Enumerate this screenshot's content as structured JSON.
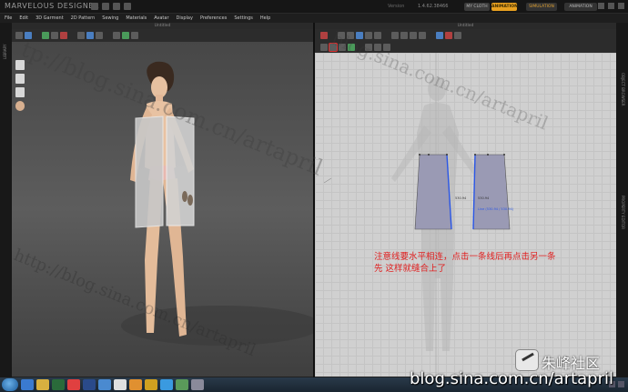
{
  "app": {
    "title": "MARVELOUS DESIGNER 4",
    "version_label": "Version",
    "version_value": "1.4.62.38466",
    "cloud_label": "MY CLOTH",
    "animation_label": "ANIMATION",
    "simulation_label": "SIMULATION",
    "mode2_label": "ANIMATION"
  },
  "menu": [
    "File",
    "Edit",
    "3D Garment",
    "2D Pattern",
    "Sewing",
    "Materials",
    "Avatar",
    "Display",
    "Preferences",
    "Settings",
    "Help"
  ],
  "panels": {
    "left_header": "Untitled",
    "right_header": "Untitled",
    "left_strip_label": "LIBRARY",
    "right_strip_label_1": "OBJECT BROWSER",
    "right_strip_label_2": "PROPERTY EDITOR"
  },
  "pattern": {
    "measure_1": "530.94",
    "measure_2": "530.94",
    "measure_3": "Line (530.94 / 530.94)"
  },
  "annotation": "注意线要水平相连，点击一条线后再点击另一条先 这样就缝合上了",
  "watermarks": {
    "diag_1": "tp://blog.sina.com.cn/artapril",
    "diag_2": "blog.sina.com.cn/artapril",
    "diag_3": "http://blog.sina.com.cn/artapril",
    "logo": "朱峰社区",
    "blog": "blog.sina.com.cn/artapril"
  },
  "colors": {
    "accent": "#e8a020",
    "pattern_fill": "#9a9ab4",
    "seam_line": "#2a56e6",
    "annotation": "#e02020"
  }
}
